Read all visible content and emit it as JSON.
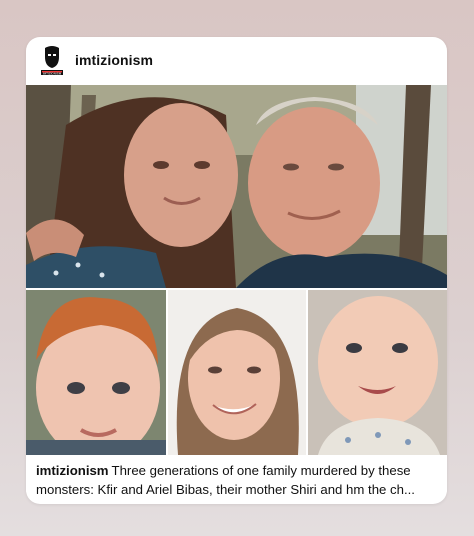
{
  "post": {
    "username": "imtizionism",
    "avatar_label": "IMTIZIONISM",
    "caption_user": "imtizionism",
    "caption_text": "Three generations of one family murdered by these monsters: Kfir and Ariel Bibas, their mother Shiri and hm the ch..."
  },
  "icons": {
    "avatar": "bearded-man-logo-icon"
  },
  "colors": {
    "background_top": "#d9c6c4",
    "card": "#ffffff",
    "text": "#111111"
  }
}
